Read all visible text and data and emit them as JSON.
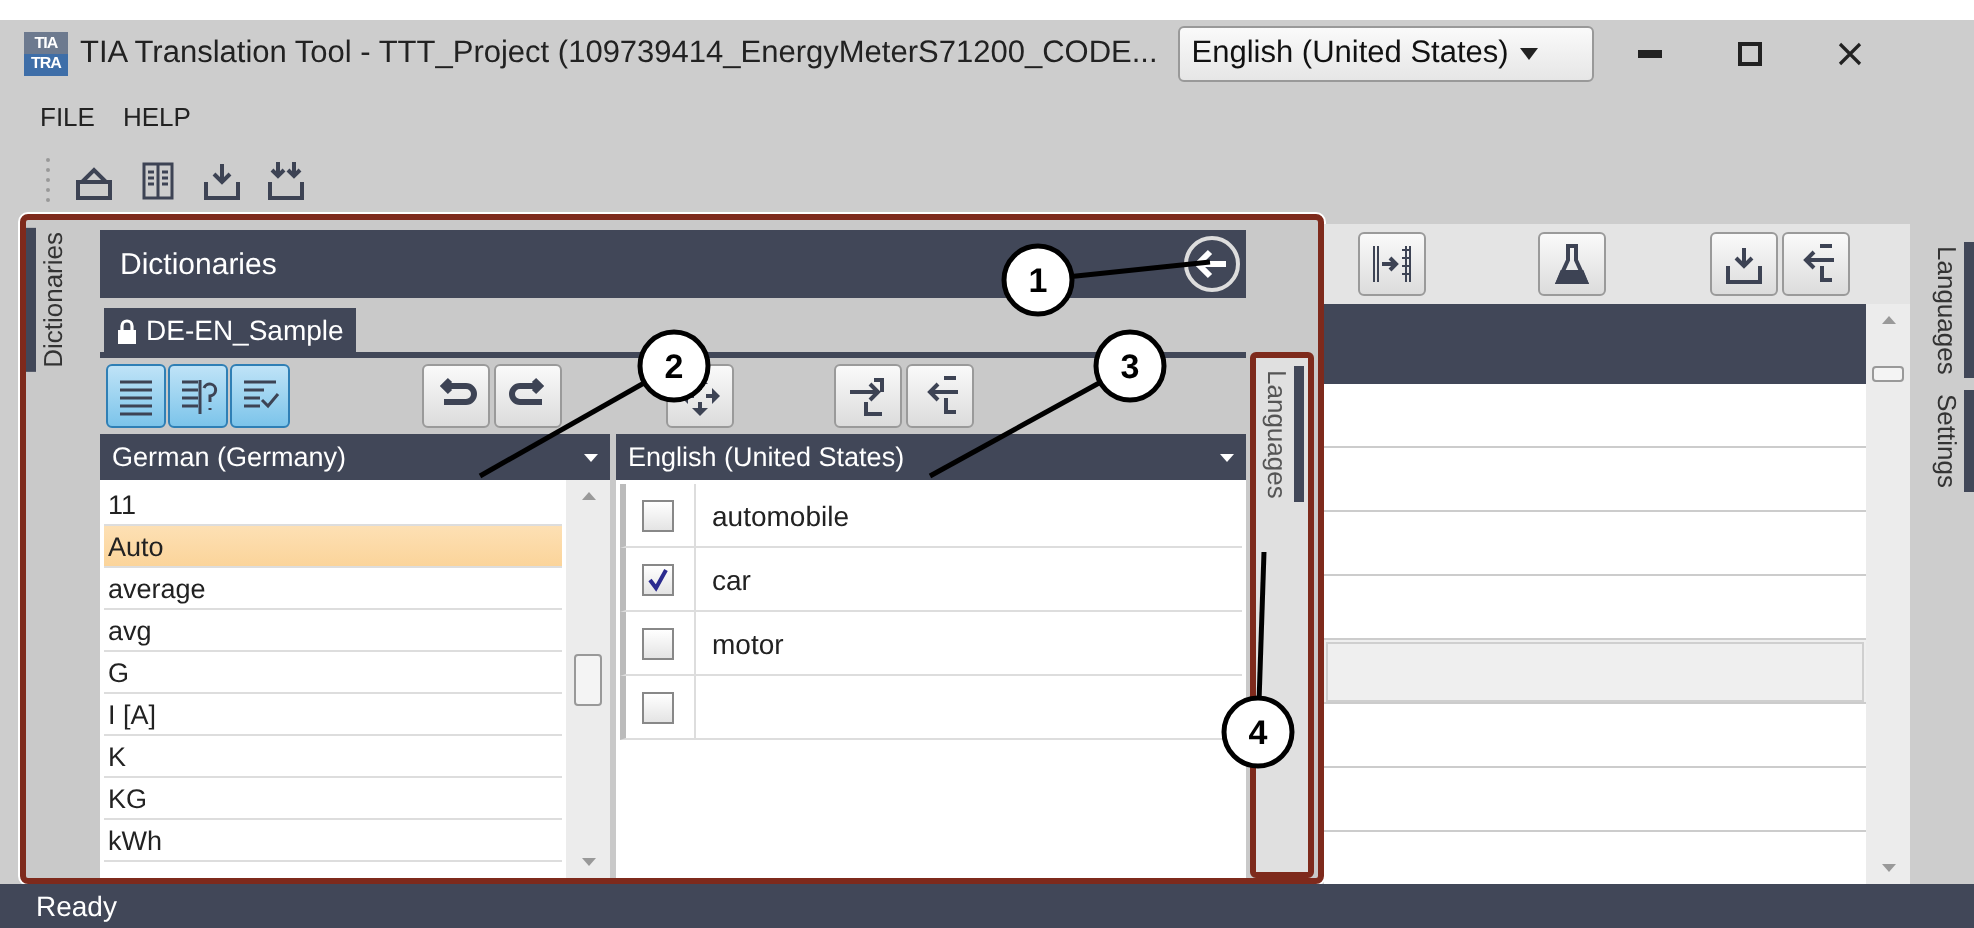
{
  "window": {
    "logo": [
      "TIA",
      "TRA"
    ],
    "title": "TIA Translation Tool - TTT_Project (109739414_EnergyMeterS71200_CODE...",
    "language_select": "English (United States)"
  },
  "menu": [
    "FILE",
    "HELP"
  ],
  "toolbar": [
    {
      "kind": "open"
    },
    {
      "kind": "columns"
    },
    {
      "kind": "import"
    },
    {
      "kind": "import-all"
    }
  ],
  "dictionaries": {
    "tab": "Dictionaries",
    "title": "Dictionaries",
    "dictionary_tab": "DE-EN_Sample",
    "toolbar": [
      {
        "kind": "list",
        "on": true
      },
      {
        "kind": "query",
        "on": true
      },
      {
        "kind": "check",
        "on": true
      },
      {
        "kind": "undo",
        "on": false
      },
      {
        "kind": "redo",
        "on": false
      },
      {
        "kind": "sync",
        "on": false
      },
      {
        "kind": "import",
        "on": false
      },
      {
        "kind": "export",
        "on": false
      }
    ],
    "source": {
      "language": "German (Germany)",
      "items": [
        {
          "text": "11",
          "selected": false
        },
        {
          "text": "Auto",
          "selected": true
        },
        {
          "text": "average",
          "selected": false
        },
        {
          "text": "avg",
          "selected": false
        },
        {
          "text": "G",
          "selected": false
        },
        {
          "text": "I [A]",
          "selected": false
        },
        {
          "text": "K",
          "selected": false
        },
        {
          "text": "KG",
          "selected": false
        },
        {
          "text": "kWh",
          "selected": false
        }
      ]
    },
    "target": {
      "language": "English (United States)",
      "items": [
        {
          "text": "automobile",
          "checked": false
        },
        {
          "text": "car",
          "checked": true
        },
        {
          "text": "motor",
          "checked": false
        },
        {
          "checked": false
        }
      ]
    },
    "side_tab": "Languages"
  },
  "grid": {
    "toolbar": [
      {
        "kind": "barcode"
      },
      {
        "kind": "flask"
      },
      {
        "kind": "import"
      },
      {
        "kind": "export"
      }
    ],
    "rows": [
      {
        "selected": false
      },
      {
        "selected": false
      },
      {
        "selected": false
      },
      {
        "selected": false
      },
      {
        "selected": true
      },
      {
        "selected": false
      },
      {
        "selected": false
      }
    ]
  },
  "side_tabs": [
    "Languages",
    "Settings"
  ],
  "callouts": [
    "1",
    "2",
    "3",
    "4"
  ],
  "status_bar": "Ready"
}
